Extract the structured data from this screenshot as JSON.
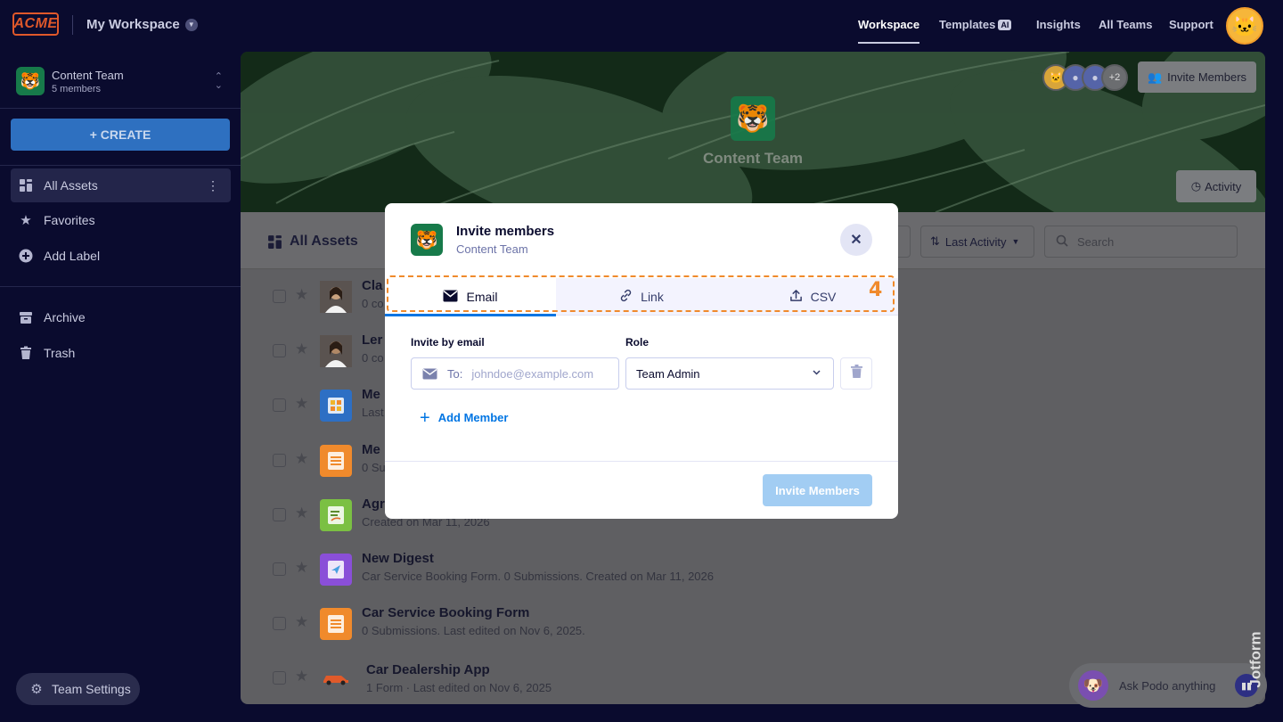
{
  "topbar": {
    "logo_text": "ACME",
    "workspace_title": "My Workspace",
    "nav": [
      "Workspace",
      "Templates",
      "Insights",
      "All Teams",
      "Support"
    ],
    "templates_badge": "AI",
    "active_nav": "Workspace"
  },
  "sidebar": {
    "team_name": "Content Team",
    "team_members": "5 members",
    "create_label": "+ CREATE",
    "items": [
      {
        "label": "All Assets",
        "icon": "grid-icon"
      },
      {
        "label": "Favorites",
        "icon": "star-icon"
      },
      {
        "label": "Add Label",
        "icon": "plus-circle-icon"
      },
      {
        "label": "Archive",
        "icon": "archive-icon"
      },
      {
        "label": "Trash",
        "icon": "trash-icon"
      }
    ],
    "team_settings_label": "Team Settings"
  },
  "banner": {
    "team_name": "Content Team",
    "avatar_more": "+2",
    "invite_label": "Invite Members",
    "activity_label": "Activity"
  },
  "assets": {
    "title": "All Assets",
    "sort_label": "Last Activity",
    "search_placeholder": "Search",
    "rows": [
      {
        "name": "Cla",
        "meta": "0 co",
        "thumb": "photo-woman",
        "color": "#c9a27e"
      },
      {
        "name": "Ler",
        "meta": "0 co",
        "thumb": "photo-man",
        "color": "#b08866"
      },
      {
        "name": "Me",
        "meta": "Last",
        "thumb": "app-icon",
        "color": "#2d6fc4"
      },
      {
        "name": "Me",
        "meta": "0 Su",
        "thumb": "form-icon",
        "color": "#f08a2c"
      },
      {
        "name": "Agr",
        "meta": "Created on Mar 11, 2026",
        "thumb": "sign-icon",
        "color": "#7bc043"
      },
      {
        "name": "New Digest",
        "meta": "Car Service Booking Form. 0 Submissions. Created on Mar 11, 2026",
        "thumb": "digest-icon",
        "color": "#8a4fd8"
      },
      {
        "name": "Car Service Booking Form",
        "meta": "0 Submissions.  Last edited on Nov 6, 2025.",
        "thumb": "form-icon",
        "color": "#f08a2c"
      },
      {
        "name": "Car Dealership App",
        "meta": "1 Form · Last edited on Nov 6, 2025",
        "thumb": "car-icon",
        "color": "#e05a2a"
      }
    ]
  },
  "podo": {
    "placeholder": "Ask Podo anything",
    "brand": "Jotform"
  },
  "modal": {
    "title": "Invite members",
    "subtitle": "Content Team",
    "tabs": [
      {
        "label": "Email",
        "icon": "envelope-icon"
      },
      {
        "label": "Link",
        "icon": "link-icon"
      },
      {
        "label": "CSV",
        "icon": "upload-icon"
      }
    ],
    "active_tab": "Email",
    "step_number": "4",
    "invite_by_email_label": "Invite by email",
    "role_label": "Role",
    "to_label": "To:",
    "email_placeholder": "johndoe@example.com",
    "email_value": "",
    "role_value": "Team Admin",
    "add_member_label": "Add Member",
    "submit_label": "Invite Members"
  }
}
